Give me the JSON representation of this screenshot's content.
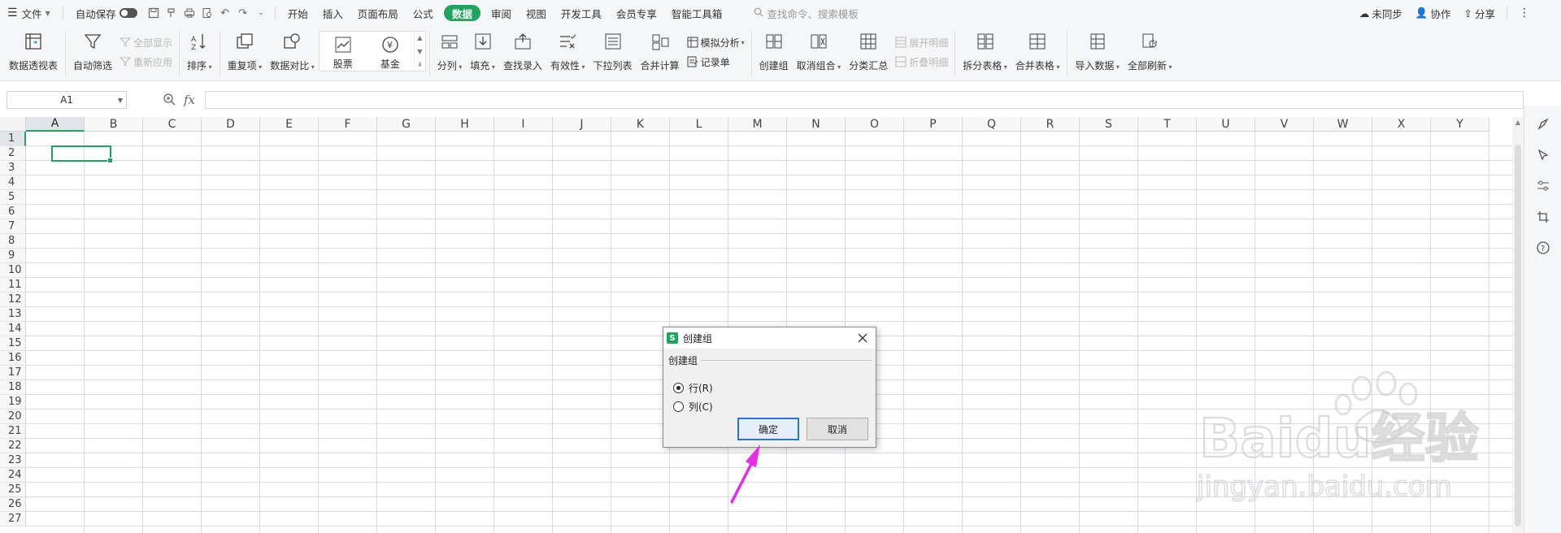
{
  "menubar": {
    "file": "文件",
    "autosave": "自动保存",
    "tabs": [
      {
        "label": "开始",
        "active": false
      },
      {
        "label": "插入",
        "active": false
      },
      {
        "label": "页面布局",
        "active": false
      },
      {
        "label": "公式",
        "active": false
      },
      {
        "label": "数据",
        "active": true
      },
      {
        "label": "审阅",
        "active": false
      },
      {
        "label": "视图",
        "active": false
      },
      {
        "label": "开发工具",
        "active": false
      },
      {
        "label": "会员专享",
        "active": false
      },
      {
        "label": "智能工具箱",
        "active": false
      }
    ],
    "search_placeholder": "查找命令、搜索模板",
    "right": {
      "sync": "未同步",
      "collab": "协作",
      "share": "分享"
    }
  },
  "ribbon": {
    "pivot": "数据透视表",
    "autofilter": "自动筛选",
    "show_all": "全部显示",
    "reapply": "重新应用",
    "sort": "排序",
    "duplicates": "重复项",
    "compare": "数据对比",
    "stock": "股票",
    "fund": "基金",
    "split_col": "分列",
    "fill": "填充",
    "lookup_entry": "查找录入",
    "validity": "有效性",
    "dropdown_list": "下拉列表",
    "consolidate": "合并计算",
    "whatif": "模拟分析",
    "record_form": "记录单",
    "create_group": "创建组",
    "ungroup": "取消组合",
    "subtotal": "分类汇总",
    "expand_detail": "展开明细",
    "collapse_detail": "折叠明细",
    "split_table": "拆分表格",
    "merge_table": "合并表格",
    "import_data": "导入数据",
    "refresh_all": "全部刷新"
  },
  "formula_bar": {
    "cell_ref": "A1",
    "fx": "fx",
    "value": ""
  },
  "sheet": {
    "columns": [
      "A",
      "B",
      "C",
      "D",
      "E",
      "F",
      "G",
      "H",
      "I",
      "J",
      "K",
      "L",
      "M",
      "N",
      "O",
      "P",
      "Q",
      "R",
      "S",
      "T",
      "U",
      "V",
      "W",
      "X",
      "Y"
    ],
    "rows": [
      "1",
      "2",
      "3",
      "4",
      "5",
      "6",
      "7",
      "8",
      "9",
      "10",
      "11",
      "12",
      "13",
      "14",
      "15",
      "16",
      "17",
      "18",
      "19",
      "20",
      "21",
      "22",
      "23",
      "24",
      "25",
      "26",
      "27"
    ],
    "selected_cell": "A1"
  },
  "dialog": {
    "title": "创建组",
    "group_label": "创建组",
    "options": [
      {
        "label": "行(R)",
        "checked": true
      },
      {
        "label": "列(C)",
        "checked": false
      }
    ],
    "ok": "确定",
    "cancel": "取消"
  },
  "watermark": {
    "brand": "Baidu经验",
    "url": "jingyan.baidu.com"
  },
  "colors": {
    "accent": "#1fa45f",
    "arrow": "#e62ee6",
    "primary_border": "#2a73d6"
  }
}
